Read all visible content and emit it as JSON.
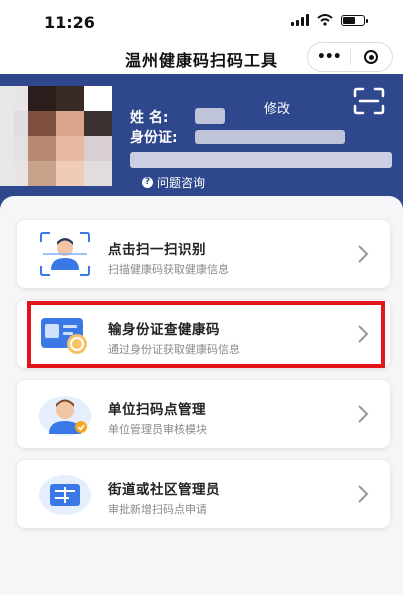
{
  "status_bar": {
    "time": "11:26"
  },
  "nav": {
    "title": "温州健康码扫码工具",
    "more": "•••"
  },
  "profile": {
    "name_label": "姓  名:",
    "id_label": "身份证:",
    "edit": "修改",
    "help_icon_char": "?",
    "help": "问题咨询"
  },
  "cards": [
    {
      "title": "点击扫一扫识别",
      "subtitle": "扫描健康码获取健康信息",
      "icon": "scan-face-icon"
    },
    {
      "title": "输身份证查健康码",
      "subtitle": "通过身份证获取健康码信息",
      "icon": "id-card-icon"
    },
    {
      "title": "单位扫码点管理",
      "subtitle": "单位管理员审核模块",
      "icon": "admin-avatar-icon"
    },
    {
      "title": "街道或社区管理员",
      "subtitle": "审批新增扫码点申请",
      "icon": "community-icon"
    }
  ],
  "colors": {
    "header": "#2f478d",
    "highlight": "#e3141b",
    "accent": "#3a78e8"
  }
}
